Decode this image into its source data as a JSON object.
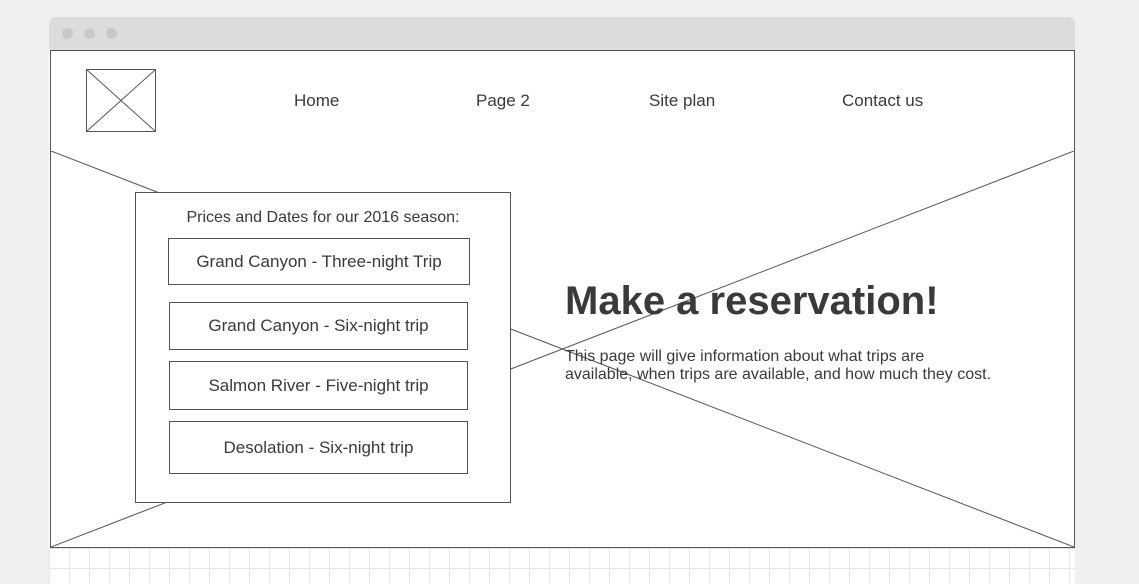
{
  "nav": {
    "home": "Home",
    "page2": "Page 2",
    "site_plan": "Site plan",
    "contact": "Contact us"
  },
  "prices": {
    "heading": "Prices and Dates for our 2016 season:",
    "trips": [
      "Grand Canyon - Three-night Trip",
      "Grand Canyon - Six-night trip",
      "Salmon River - Five-night trip",
      "Desolation - Six-night trip"
    ]
  },
  "reservation": {
    "title": "Make a reservation!",
    "text": "This page will give information about what trips are available, when trips are available, and how much they cost."
  },
  "icons": {
    "logo": "image-placeholder-icon",
    "hero": "image-placeholder-icon"
  },
  "colors": {
    "stroke": "#555555",
    "text": "#3a3a3a",
    "titlebar": "#dcdcdc",
    "page_bg": "#f0f0f0"
  }
}
